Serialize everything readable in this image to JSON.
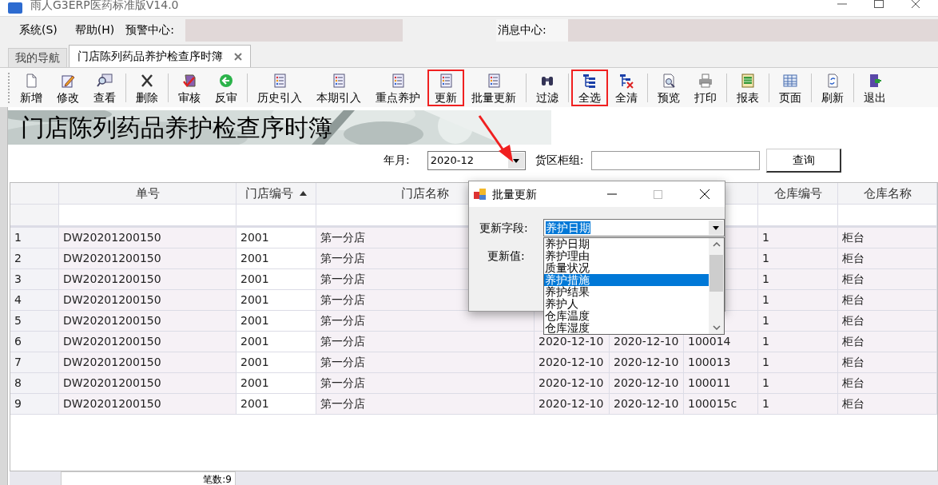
{
  "window": {
    "title": "雨人G3ERP医药标准版V14.0"
  },
  "menu": [
    {
      "label": "系统(S)"
    },
    {
      "label": "帮助(H)"
    }
  ],
  "alert_center": {
    "label": "预警中心:"
  },
  "message_center": {
    "label": "消息中心:"
  },
  "tabs": [
    {
      "label": "我的导航",
      "selected": false,
      "closable": false
    },
    {
      "label": "门店陈列药品养护检查序时簿",
      "selected": true,
      "closable": true
    }
  ],
  "toolbar": [
    [
      {
        "label": "新增",
        "highlighted": false
      },
      {
        "label": "修改",
        "highlighted": false
      },
      {
        "label": "查看",
        "highlighted": false
      }
    ],
    [
      {
        "label": "删除",
        "highlighted": false
      }
    ],
    [
      {
        "label": "审核",
        "highlighted": false
      },
      {
        "label": "反审",
        "highlighted": false
      }
    ],
    [
      {
        "label": "历史引入",
        "highlighted": false
      },
      {
        "label": "本期引入",
        "highlighted": false
      },
      {
        "label": "重点养护",
        "highlighted": false
      },
      {
        "label": "更新",
        "highlighted": true
      },
      {
        "label": "批量更新",
        "highlighted": false
      }
    ],
    [
      {
        "label": "过滤",
        "highlighted": false
      }
    ],
    [
      {
        "label": "全选",
        "highlighted": true
      },
      {
        "label": "全清",
        "highlighted": false
      }
    ],
    [
      {
        "label": "预览",
        "highlighted": false
      },
      {
        "label": "打印",
        "highlighted": false
      }
    ],
    [
      {
        "label": "报表",
        "highlighted": false
      }
    ],
    [
      {
        "label": "页面",
        "highlighted": false
      }
    ],
    [
      {
        "label": "刷新",
        "highlighted": false
      }
    ],
    [
      {
        "label": "退出",
        "highlighted": false
      }
    ]
  ],
  "banner": {
    "title": "门店陈列药品养护检查序时簿"
  },
  "filters": {
    "year_month": {
      "label": "年月:",
      "value": "2020-12"
    },
    "shelf_group": {
      "label": "货区柜组:"
    },
    "query_button": "查询"
  },
  "table": {
    "columns": [
      {
        "label": "单号",
        "sorted": false
      },
      {
        "label": "门店编号",
        "sorted": true
      },
      {
        "label": "门店名称",
        "sorted": false
      },
      {
        "label": "仓库编号",
        "sorted": false
      },
      {
        "label": "仓库名称",
        "sorted": false
      }
    ],
    "rows": [
      {
        "number": "1",
        "cells": [
          "DW20201200150",
          "2001",
          "第一分店",
          "1",
          "柜台"
        ]
      },
      {
        "number": "2",
        "cells": [
          "DW20201200150",
          "2001",
          "第一分店",
          "1",
          "柜台"
        ]
      },
      {
        "number": "3",
        "cells": [
          "DW20201200150",
          "2001",
          "第一分店",
          "1",
          "柜台"
        ]
      },
      {
        "number": "4",
        "cells": [
          "DW20201200150",
          "2001",
          "第一分店",
          "1",
          "柜台"
        ]
      },
      {
        "number": "5",
        "cells": [
          "DW20201200150",
          "2001",
          "第一分店",
          "1",
          "柜台"
        ]
      },
      {
        "number": "6",
        "cells": [
          "DW20201200150",
          "2001",
          "第一分店",
          "1",
          "柜台"
        ],
        "column_5": "2020-12-10",
        "column_6": "2020-12-10",
        "column_7": "100014"
      },
      {
        "number": "7",
        "cells": [
          "DW20201200150",
          "2001",
          "第一分店",
          "1",
          "柜台"
        ],
        "column_5": "2020-12-10",
        "column_6": "2020-12-10",
        "column_7": "100013"
      },
      {
        "number": "8",
        "cells": [
          "DW20201200150",
          "2001",
          "第一分店",
          "1",
          "柜台"
        ],
        "column_5": "2020-12-10",
        "column_6": "2020-12-10",
        "column_7": "100011"
      },
      {
        "number": "9",
        "cells": [
          "DW20201200150",
          "2001",
          "第一分店",
          "1",
          "柜台"
        ],
        "column_5": "2020-12-10",
        "column_6": "2020-12-10",
        "column_7": "100015c"
      }
    ]
  },
  "footer": {
    "count": "笔数:9"
  },
  "dialog": {
    "title": "批量更新",
    "field": {
      "label": "更新字段:",
      "value": "养护日期"
    },
    "value": {
      "label": "更新值:"
    },
    "options": [
      {
        "label": "养护日期",
        "selected": false
      },
      {
        "label": "养护理由",
        "selected": false
      },
      {
        "label": "质量状况",
        "selected": false
      },
      {
        "label": "养护措施",
        "selected": true
      },
      {
        "label": "养护结果",
        "selected": false
      },
      {
        "label": "养护人",
        "selected": false
      },
      {
        "label": "仓库温度",
        "selected": false
      },
      {
        "label": "仓库湿度",
        "selected": false
      }
    ]
  }
}
